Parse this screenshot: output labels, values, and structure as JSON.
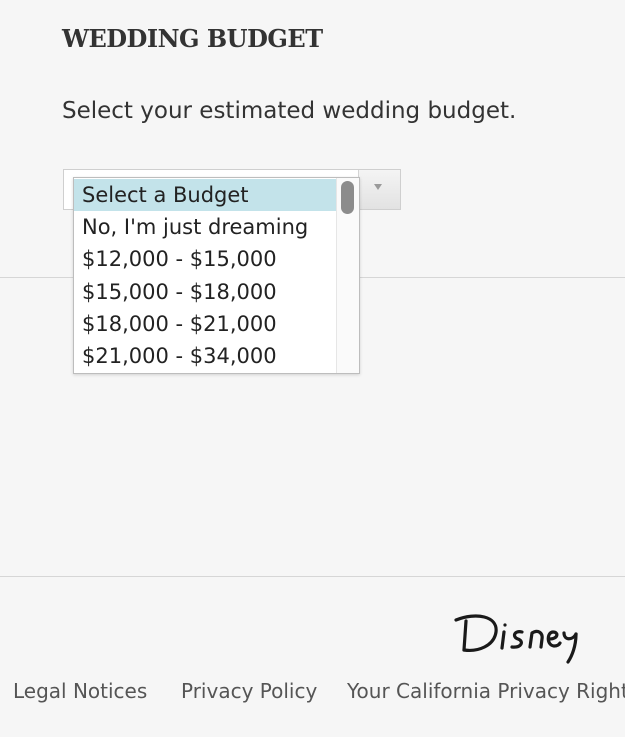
{
  "section": {
    "title": "WEDDING BUDGET",
    "prompt": "Select your estimated wedding budget."
  },
  "budget_select": {
    "selected_value": "Select a Budget",
    "options": [
      "Select a Budget",
      "No, I'm just dreaming",
      "$12,000 - $15,000",
      "$15,000 - $18,000",
      "$18,000 - $21,000",
      "$21,000 - $34,000"
    ],
    "highlight_color": "#c3e3ea",
    "scroll_position": 0
  },
  "footer": {
    "brand": "Disney",
    "links": [
      "Legal Notices",
      "Privacy Policy",
      "Your California Privacy Rights"
    ]
  }
}
